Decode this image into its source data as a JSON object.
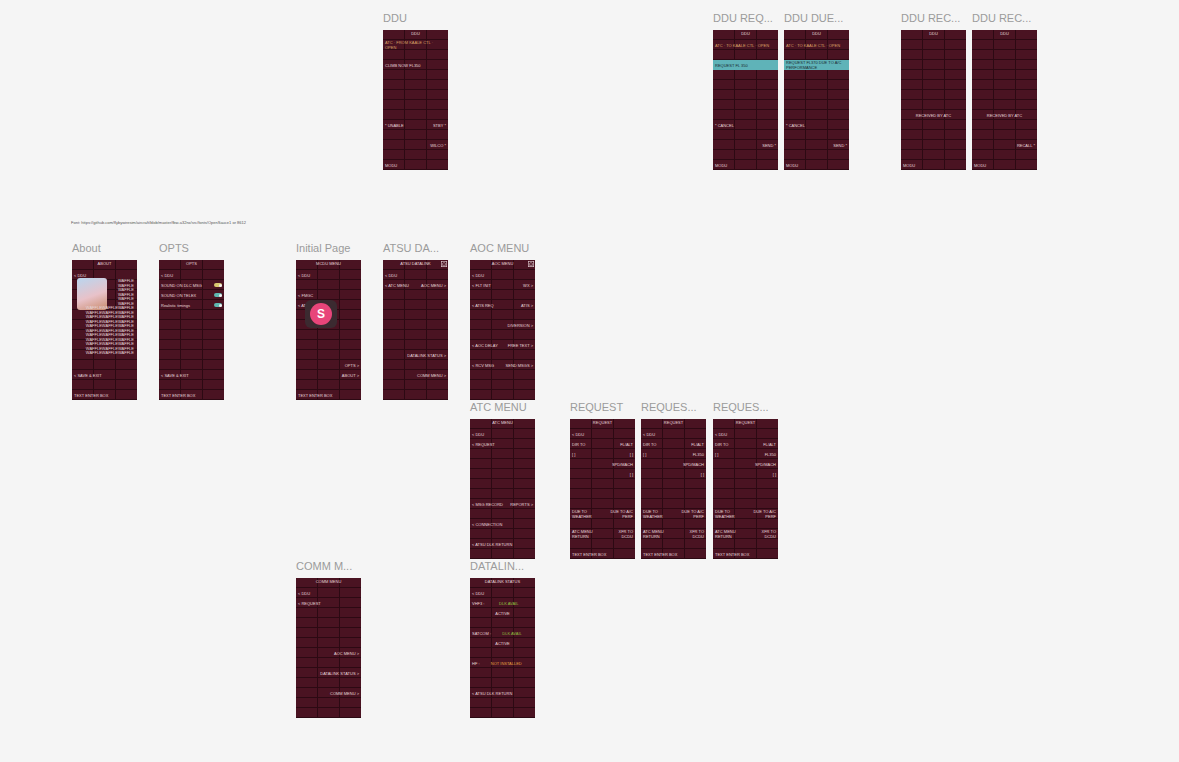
{
  "canvas": {
    "note": "Font: https://github.com/flybywiresim/aircraft/blob/master/fbw-a32nx/src/fonts/OpenSauce1 or 8612"
  },
  "cursor": {
    "initial": "S",
    "color": "#e8457a"
  },
  "frames": [
    {
      "label": "DDU",
      "home": false,
      "highlight": "",
      "accents": [
        {
          "text": "ATC · FROM KAALE CTL · OPEN",
          "color": "#d9a066"
        }
      ],
      "rows": [
        [
          "",
          "DDU",
          ""
        ],
        [
          "ATC · FROM KAALE CTL · OPEN",
          "",
          ""
        ],
        [
          "",
          "",
          ""
        ],
        [
          "CLIMB NOW FL350",
          "",
          ""
        ],
        [
          "",
          "",
          ""
        ],
        [
          "",
          "",
          ""
        ],
        [
          "",
          "",
          ""
        ],
        [
          "",
          "",
          ""
        ],
        [
          "",
          "",
          ""
        ],
        [
          "* UNABLE",
          "",
          "STBY *"
        ],
        [
          "",
          "",
          ""
        ],
        [
          "",
          "",
          "WILCO *"
        ],
        [
          "",
          "",
          ""
        ],
        [
          "MODU",
          "",
          ""
        ]
      ]
    },
    {
      "label": "DDU REQ...",
      "home": false,
      "highlight": "REQUEST FL 350",
      "accents": [
        {
          "text": "ATC · TO KAALE CTL · OPEN",
          "color": "#d9a066"
        }
      ],
      "rows": [
        [
          "",
          "DDU",
          ""
        ],
        [
          "ATC · TO KAALE CTL · OPEN",
          "",
          ""
        ],
        [
          "",
          "",
          ""
        ],
        [
          "REQUEST FL 350",
          "",
          ""
        ],
        [
          "",
          "",
          ""
        ],
        [
          "",
          "",
          ""
        ],
        [
          "",
          "",
          ""
        ],
        [
          "",
          "",
          ""
        ],
        [
          "",
          "",
          ""
        ],
        [
          "* CANCEL",
          "",
          ""
        ],
        [
          "",
          "",
          ""
        ],
        [
          "",
          "",
          "SEND *"
        ],
        [
          "",
          "",
          ""
        ],
        [
          "MODU",
          "",
          ""
        ]
      ]
    },
    {
      "label": "DDU DUE...",
      "home": false,
      "highlight": "REQUEST FL370 DUE TO A/C PERFORMANCE",
      "accents": [
        {
          "text": "ATC · TO KAALE CTL · OPEN",
          "color": "#d9a066"
        }
      ],
      "rows": [
        [
          "",
          "DDU",
          ""
        ],
        [
          "ATC · TO KAALE CTL · OPEN",
          "",
          ""
        ],
        [
          "",
          "",
          ""
        ],
        [
          "REQUEST FL370 DUE TO A/C PERFORMANCE",
          "",
          ""
        ],
        [
          "",
          "",
          ""
        ],
        [
          "",
          "",
          ""
        ],
        [
          "",
          "",
          ""
        ],
        [
          "",
          "",
          ""
        ],
        [
          "",
          "",
          ""
        ],
        [
          "* CANCEL",
          "",
          ""
        ],
        [
          "",
          "",
          ""
        ],
        [
          "",
          "",
          "SEND *"
        ],
        [
          "",
          "",
          ""
        ],
        [
          "MODU",
          "",
          ""
        ]
      ]
    },
    {
      "label": "DDU REC...",
      "home": false,
      "highlight": "",
      "accents": [],
      "rows": [
        [
          "",
          "DDU",
          ""
        ],
        [
          "",
          "",
          ""
        ],
        [
          "",
          "",
          ""
        ],
        [
          "",
          "",
          ""
        ],
        [
          "",
          "",
          ""
        ],
        [
          "",
          "",
          ""
        ],
        [
          "",
          "",
          ""
        ],
        [
          "",
          "",
          ""
        ],
        [
          "",
          "RECEIVED BY ATC",
          ""
        ],
        [
          "",
          "",
          ""
        ],
        [
          "",
          "",
          ""
        ],
        [
          "",
          "",
          ""
        ],
        [
          "",
          "",
          ""
        ],
        [
          "MODU",
          "",
          ""
        ]
      ]
    },
    {
      "label": "DDU REC...",
      "home": false,
      "highlight": "",
      "accents": [],
      "rows": [
        [
          "",
          "DDU",
          ""
        ],
        [
          "",
          "",
          ""
        ],
        [
          "",
          "",
          ""
        ],
        [
          "",
          "",
          ""
        ],
        [
          "",
          "",
          ""
        ],
        [
          "",
          "",
          ""
        ],
        [
          "",
          "",
          ""
        ],
        [
          "",
          "",
          ""
        ],
        [
          "",
          "RECEIVED BY ATC",
          ""
        ],
        [
          "",
          "",
          ""
        ],
        [
          "",
          "",
          ""
        ],
        [
          "",
          "",
          "RECALL *"
        ],
        [
          "",
          "",
          ""
        ],
        [
          "MODU",
          "",
          ""
        ]
      ]
    },
    {
      "label": "About",
      "home": false,
      "highlight": "",
      "accents": [],
      "picture": true,
      "lines": [
        "WAFFLE",
        "WAFFLE",
        "WAFFLE",
        "WAFFLE",
        "WAFFLE",
        "WAFFLE",
        "WAFFLEWAFFLEWAFFLE",
        "WAFFLEWAFFLEWAFFLE",
        "WAFFLEWAFFLEWAFFLE",
        "WAFFLEWAFFLEWAFFLE",
        "WAFFLEWAFFLEWAFFLE",
        "WAFFLEWAFFLEWAFFLE",
        "WAFFLEWAFFLEWAFFLE",
        "WAFFLEWAFFLEWAFFLE",
        "WAFFLEWAFFLEWAFFLE",
        "WAFFLEWAFFLEWAFFLE",
        "WAFFLEWAFFLEWAFFLE"
      ],
      "rows": [
        [
          "",
          "ABOUT",
          ""
        ],
        [
          "< DDU",
          "",
          ""
        ],
        [
          "",
          "",
          ""
        ],
        [
          "",
          "",
          ""
        ],
        [
          "",
          "",
          ""
        ],
        [
          "",
          "",
          ""
        ],
        [
          "",
          "",
          ""
        ],
        [
          "",
          "",
          ""
        ],
        [
          "",
          "",
          ""
        ],
        [
          "",
          "",
          ""
        ],
        [
          "",
          "",
          ""
        ],
        [
          "< SAVE & EXIT",
          "",
          ""
        ],
        [
          "",
          "",
          ""
        ],
        [
          "TEXT ENTER BOX",
          "",
          ""
        ]
      ]
    },
    {
      "label": "OPTS",
      "home": false,
      "highlight": "",
      "accents": [],
      "toggles": [
        {
          "label": "SOUND ON DLC MSG",
          "on": true,
          "color": "#d8c870"
        },
        {
          "label": "SOUND ON TELEX",
          "on": true,
          "color": "#5fb7b0"
        },
        {
          "label": "Realistic timings",
          "on": true,
          "color": "#5fb7b0"
        }
      ],
      "rows": [
        [
          "",
          "OPTS",
          ""
        ],
        [
          "< DDU",
          "",
          ""
        ],
        [
          "SOUND ON DLC MSG",
          "",
          ""
        ],
        [
          "SOUND ON TELEX",
          "",
          ""
        ],
        [
          "Realistic timings",
          "",
          ""
        ],
        [
          "",
          "",
          ""
        ],
        [
          "",
          "",
          ""
        ],
        [
          "",
          "",
          ""
        ],
        [
          "",
          "",
          ""
        ],
        [
          "",
          "",
          ""
        ],
        [
          "",
          "",
          ""
        ],
        [
          "< SAVE & EXIT",
          "",
          ""
        ],
        [
          "",
          "",
          ""
        ],
        [
          "TEXT ENTER BOX",
          "",
          ""
        ]
      ]
    },
    {
      "label": "Initial Page",
      "home": false,
      "highlight": "",
      "accents": [],
      "rows": [
        [
          "",
          "MCDU MENU",
          ""
        ],
        [
          "< DDU",
          "",
          ""
        ],
        [
          "",
          "",
          ""
        ],
        [
          "< FMGC",
          "",
          ""
        ],
        [
          "< ATSU",
          "",
          ""
        ],
        [
          "",
          "",
          ""
        ],
        [
          "",
          "",
          ""
        ],
        [
          "",
          "",
          ""
        ],
        [
          "",
          "",
          ""
        ],
        [
          "",
          "",
          ""
        ],
        [
          "",
          "",
          "OPTS >"
        ],
        [
          "",
          "",
          "ABOUT >"
        ],
        [
          "",
          "",
          ""
        ],
        [
          "TEXT ENTER BOX",
          "",
          ""
        ]
      ]
    },
    {
      "label": "ATSU DA...",
      "home": true,
      "highlight": "",
      "accents": [],
      "rows": [
        [
          "",
          "ATSU DATALINK",
          ""
        ],
        [
          "< DDU",
          "",
          ""
        ],
        [
          "< ATC MENU",
          "",
          "AOC MENU >"
        ],
        [
          "",
          "",
          ""
        ],
        [
          "",
          "",
          ""
        ],
        [
          "",
          "",
          ""
        ],
        [
          "",
          "",
          ""
        ],
        [
          "",
          "",
          ""
        ],
        [
          "",
          "",
          ""
        ],
        [
          "",
          "",
          "DATALINK STATUS >"
        ],
        [
          "",
          "",
          ""
        ],
        [
          "",
          "",
          "COMM MENU >"
        ],
        [
          "",
          "",
          ""
        ],
        [
          "",
          "",
          ""
        ]
      ]
    },
    {
      "label": "AOC MENU",
      "home": true,
      "highlight": "",
      "accents": [],
      "rows": [
        [
          "",
          "AOC MENU",
          ""
        ],
        [
          "< DDU",
          "",
          ""
        ],
        [
          "< FLT INIT",
          "",
          "WX >"
        ],
        [
          "",
          "",
          ""
        ],
        [
          "< ATIS REQ",
          "",
          "ATIS >"
        ],
        [
          "",
          "",
          ""
        ],
        [
          "",
          "",
          "DIVERSION >"
        ],
        [
          "",
          "",
          ""
        ],
        [
          "< AOC DELAY",
          "",
          "FREE TEXT >"
        ],
        [
          "",
          "",
          ""
        ],
        [
          "< RCV MSG",
          "",
          "SEND MSGS >"
        ],
        [
          "",
          "",
          ""
        ],
        [
          "",
          "",
          ""
        ],
        [
          "",
          "",
          ""
        ]
      ]
    },
    {
      "label": "ATC MENU",
      "home": false,
      "highlight": "",
      "accents": [],
      "rows": [
        [
          "",
          "ATC MENU",
          ""
        ],
        [
          "< DDU",
          "",
          ""
        ],
        [
          "< REQUEST",
          "",
          ""
        ],
        [
          "",
          "",
          ""
        ],
        [
          "",
          "",
          ""
        ],
        [
          "",
          "",
          ""
        ],
        [
          "",
          "",
          ""
        ],
        [
          "",
          "",
          ""
        ],
        [
          "< MSG RECORD",
          "",
          "REPORTS >"
        ],
        [
          "",
          "",
          ""
        ],
        [
          "< CONNECTION",
          "",
          ""
        ],
        [
          "",
          "",
          ""
        ],
        [
          "< ATSU DLK RETURN",
          "",
          ""
        ],
        [
          "",
          "",
          ""
        ]
      ]
    },
    {
      "label": "REQUEST",
      "home": false,
      "highlight": "",
      "accents": [],
      "rows": [
        [
          "",
          "REQUEST",
          ""
        ],
        [
          "< DDU",
          "",
          ""
        ],
        [
          "DIR TO",
          "",
          "FL/ALT"
        ],
        [
          "[    ]",
          "",
          "[    ]"
        ],
        [
          "",
          "",
          "SPD/MACH"
        ],
        [
          "",
          "",
          "[    ]"
        ],
        [
          "",
          "",
          ""
        ],
        [
          "",
          "",
          ""
        ],
        [
          "",
          "",
          ""
        ],
        [
          "DUE TO WEATHER",
          "",
          "DUE TO A/C PERF"
        ],
        [
          "",
          "",
          ""
        ],
        [
          "ATC MENU RETURN",
          "",
          "XFR TO DCDU"
        ],
        [
          "",
          "",
          ""
        ],
        [
          "TEXT ENTER BOX",
          "",
          ""
        ]
      ]
    },
    {
      "label": "REQUES...",
      "home": false,
      "highlight": "",
      "accents": [],
      "rows": [
        [
          "",
          "REQUEST",
          ""
        ],
        [
          "< DDU",
          "",
          ""
        ],
        [
          "DIR TO",
          "",
          "FL/ALT"
        ],
        [
          "[    ]",
          "",
          "FL350"
        ],
        [
          "",
          "",
          "SPD/MACH"
        ],
        [
          "",
          "",
          "[    ]"
        ],
        [
          "",
          "",
          ""
        ],
        [
          "",
          "",
          ""
        ],
        [
          "",
          "",
          ""
        ],
        [
          "DUE TO WEATHER",
          "",
          "DUE TO A/C PERF"
        ],
        [
          "",
          "",
          ""
        ],
        [
          "ATC MENU RETURN",
          "",
          "XFR TO DCDU"
        ],
        [
          "",
          "",
          ""
        ],
        [
          "TEXT ENTER BOX",
          "",
          ""
        ]
      ]
    },
    {
      "label": "REQUES...",
      "home": false,
      "highlight": "",
      "accents": [],
      "rows": [
        [
          "",
          "REQUEST",
          ""
        ],
        [
          "< DDU",
          "",
          ""
        ],
        [
          "DIR TO",
          "",
          "FL/ALT"
        ],
        [
          "[    ]",
          "",
          "FL350"
        ],
        [
          "",
          "",
          "SPD/MACH"
        ],
        [
          "",
          "",
          "[    ]"
        ],
        [
          "",
          "",
          ""
        ],
        [
          "",
          "",
          ""
        ],
        [
          "",
          "",
          ""
        ],
        [
          "DUE TO WEATHER",
          "",
          "DUE TO A/C PERF"
        ],
        [
          "",
          "",
          ""
        ],
        [
          "ATC MENU RETURN",
          "",
          "XFR TO DCDU"
        ],
        [
          "",
          "",
          ""
        ],
        [
          "TEXT ENTER BOX",
          "",
          ""
        ]
      ]
    },
    {
      "label": "COMM M...",
      "home": false,
      "highlight": "",
      "accents": [],
      "rows": [
        [
          "",
          "COMM MENU",
          ""
        ],
        [
          "< DDU",
          "",
          ""
        ],
        [
          "< REQUEST",
          "",
          ""
        ],
        [
          "",
          "",
          ""
        ],
        [
          "",
          "",
          ""
        ],
        [
          "",
          "",
          ""
        ],
        [
          "",
          "",
          ""
        ],
        [
          "",
          "",
          "AOC MENU >"
        ],
        [
          "",
          "",
          ""
        ],
        [
          "",
          "",
          "DATALINK STATUS >"
        ],
        [
          "",
          "",
          ""
        ],
        [
          "",
          "",
          "COMM MENU >"
        ],
        [
          "",
          "",
          ""
        ],
        [
          "",
          "",
          ""
        ]
      ]
    },
    {
      "label": "DATALIN...",
      "home": false,
      "highlight": "",
      "accents": [
        {
          "text": "DLK AVAIL",
          "color": "#8fbf3f"
        },
        {
          "text": "NOT INSTALLED",
          "color": "#e0a040"
        }
      ],
      "rows": [
        [
          "",
          "DATALINK STATUS",
          ""
        ],
        [
          "< DDU",
          "",
          ""
        ],
        [
          "VHF3 :",
          "DLK AVAIL",
          ""
        ],
        [
          "",
          "ACTIVE",
          ""
        ],
        [
          "",
          "",
          ""
        ],
        [
          "SATCOM :",
          "DLK AVAIL",
          ""
        ],
        [
          "",
          "ACTIVE",
          ""
        ],
        [
          "",
          "",
          ""
        ],
        [
          "HF :",
          "NOT INSTALLED",
          ""
        ],
        [
          "",
          "",
          ""
        ],
        [
          "",
          "",
          ""
        ],
        [
          "< ATSU DLK RETURN",
          "",
          ""
        ],
        [
          "",
          "",
          ""
        ],
        [
          "",
          "",
          ""
        ]
      ]
    }
  ]
}
